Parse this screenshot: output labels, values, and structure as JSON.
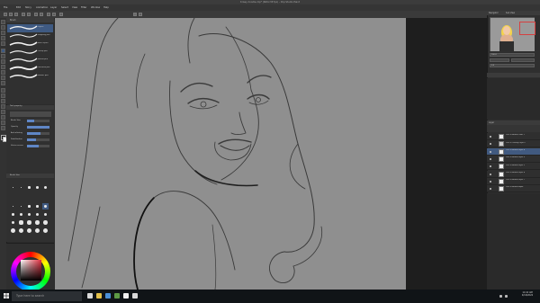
{
  "app": {
    "title": "Krissy doodle.clip* (600×337px) - Clip Studio Paint",
    "menus": [
      "File",
      "Edit",
      "Story",
      "Animation",
      "Layer",
      "Select",
      "View",
      "Filter",
      "Window",
      "Help"
    ]
  },
  "subtool": {
    "tab_label": "Brush",
    "brushes": [
      {
        "name": "G-pen"
      },
      {
        "name": "Mapping pen"
      },
      {
        "name": "Real G-pen"
      },
      {
        "name": "Turnip pen"
      },
      {
        "name": "Round pen"
      },
      {
        "name": "Textured pen"
      },
      {
        "name": "Marker pen"
      }
    ],
    "selected_index": 0
  },
  "tool_property": {
    "title": "Tool property",
    "rows": [
      {
        "label": "Brush Size",
        "value": 0.3
      },
      {
        "label": "Opacity",
        "value": 1.0
      },
      {
        "label": "Anti-aliasing",
        "value": 0.6
      },
      {
        "label": "Stabilization",
        "value": 0.4
      },
      {
        "label": "Vector eraser",
        "value": 0.5
      }
    ]
  },
  "brush_size": {
    "title": "Brush Size",
    "sizes": [
      "0.7",
      "1",
      "1.5",
      "2",
      "2.5",
      "3",
      "4",
      "5",
      "6",
      "7",
      "8",
      "10",
      "12",
      "15",
      "17",
      "20",
      "25",
      "30",
      "40",
      "50"
    ]
  },
  "color": {
    "main": "#1a1a1a",
    "sub": "#ffffff",
    "accent": "#e03040"
  },
  "navigator": {
    "tabs": [
      "Navigator",
      "Sub View"
    ],
    "zoom": "100.0",
    "rotate": "0.0"
  },
  "layers": {
    "title": "Layer",
    "items": [
      {
        "name": "100 % Normal Color 1"
      },
      {
        "name": "100 % Overlay Layer 5"
      },
      {
        "name": "100 % Normal Layer 4"
      },
      {
        "name": "100 % Normal Layer 3"
      },
      {
        "name": "100 % Normal Layer 2"
      },
      {
        "name": "100 % Normal Layer 6"
      },
      {
        "name": "100 % Normal Layer 7"
      },
      {
        "name": "100 % Normal Paper"
      }
    ],
    "selected_index": 2
  },
  "taskbar": {
    "search_placeholder": "Type here to search",
    "time": "11:16 AM",
    "date": "4/19/2022"
  }
}
